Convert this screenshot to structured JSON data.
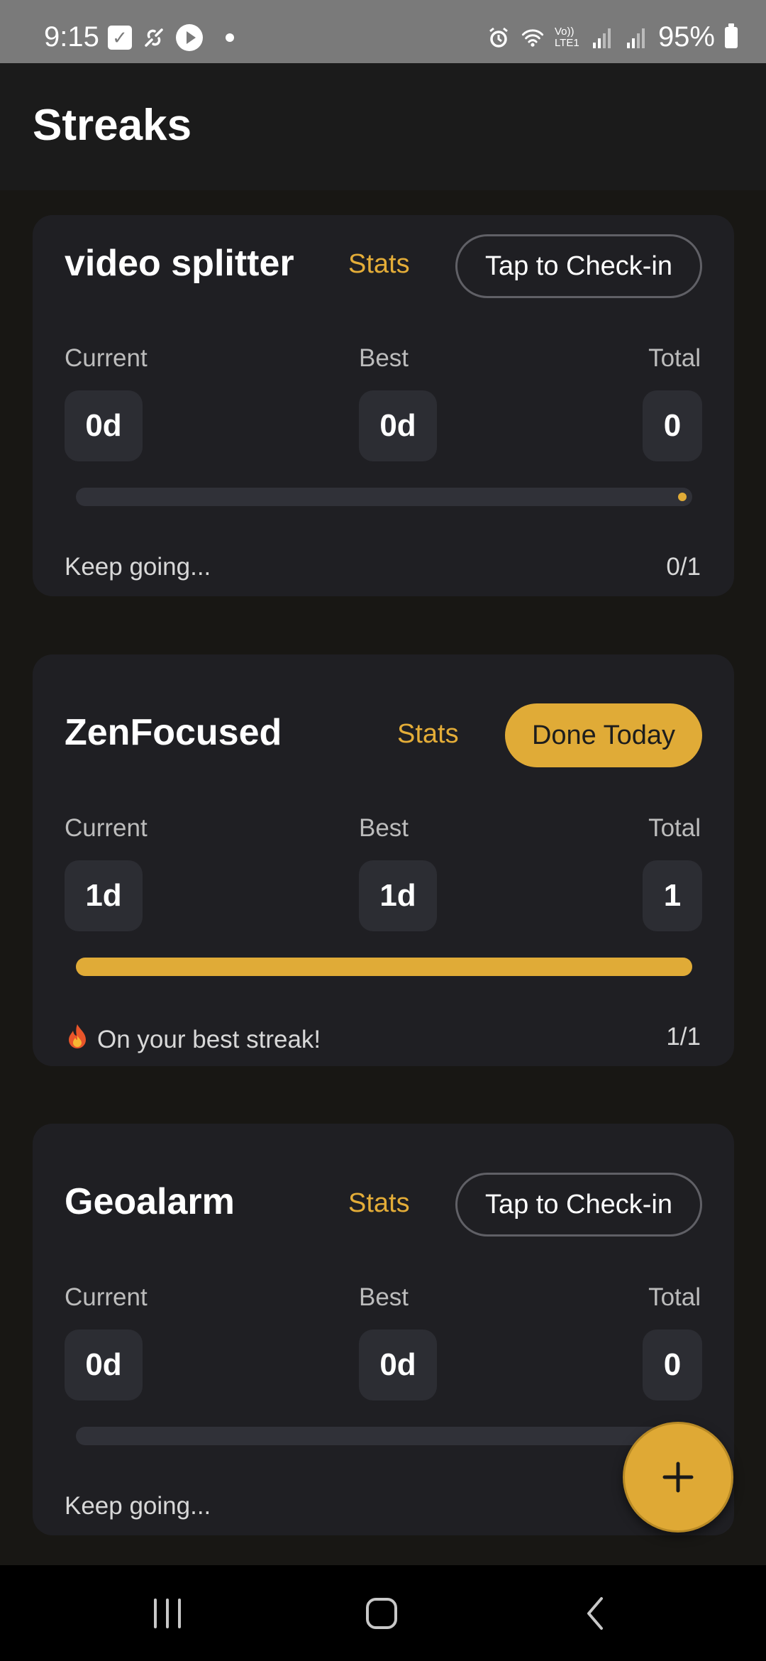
{
  "status_bar": {
    "time": "9:15",
    "battery": "95%",
    "network": "Vo)) LTE1"
  },
  "app": {
    "title": "Streaks"
  },
  "colors": {
    "accent": "#e0ab37",
    "card_bg": "#1f1f23",
    "page_bg": "#181714"
  },
  "cards": [
    {
      "name": "video splitter",
      "stats_label": "Stats",
      "action_label": "Tap to Check-in",
      "action_state": "outline",
      "current_label": "Current",
      "current_value": "0d",
      "best_label": "Best",
      "best_value": "0d",
      "total_label": "Total",
      "total_value": "0",
      "progress": 0,
      "status_text": "Keep going...",
      "count_text": "0/1"
    },
    {
      "name": "ZenFocused",
      "stats_label": "Stats",
      "action_label": "Done Today",
      "action_state": "filled",
      "current_label": "Current",
      "current_value": "1d",
      "best_label": "Best",
      "best_value": "1d",
      "total_label": "Total",
      "total_value": "1",
      "progress": 1,
      "status_icon": "fire-icon",
      "status_text": "On your best streak!",
      "count_text": "1/1"
    },
    {
      "name": "Geoalarm",
      "stats_label": "Stats",
      "action_label": "Tap to Check-in",
      "action_state": "outline",
      "current_label": "Current",
      "current_value": "0d",
      "best_label": "Best",
      "best_value": "0d",
      "total_label": "Total",
      "total_value": "0",
      "progress": 0,
      "status_text": "Keep going..."
    }
  ],
  "fab": {
    "icon": "plus-icon"
  },
  "nav": {
    "recents": "recents-icon",
    "home": "home-icon",
    "back": "back-icon"
  }
}
